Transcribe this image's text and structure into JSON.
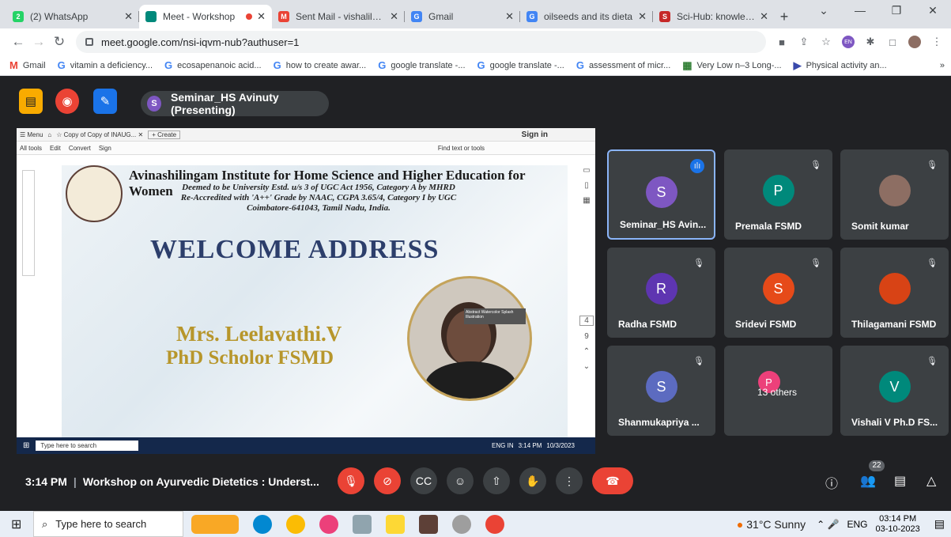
{
  "tabs": [
    {
      "title": "(2) WhatsApp",
      "color": "#25d366",
      "glyph": "2"
    },
    {
      "title": "Meet - Workshop",
      "color": "#00897b",
      "glyph": "",
      "active": true
    },
    {
      "title": "Sent Mail - vishalilekh",
      "color": "#ea4335",
      "glyph": "M"
    },
    {
      "title": "Gmail",
      "color": "#4285f4",
      "glyph": "G"
    },
    {
      "title": "oilseeds and its dieta",
      "color": "#4285f4",
      "glyph": "G"
    },
    {
      "title": "Sci-Hub: knowledge",
      "color": "#c62828",
      "glyph": "S"
    }
  ],
  "address": {
    "url": "meet.google.com/nsi-iqvm-nub?authuser=1"
  },
  "bookmarks": [
    "Gmail",
    "vitamin a deficiency...",
    "ecosapenanoic acid...",
    "how to create awar...",
    "google translate -...",
    "google translate -...",
    "assessment of micr...",
    "Very Low n–3 Long-...",
    "Physical activity an..."
  ],
  "meeting": {
    "presenting": "Seminar_HS Avinuty (Presenting)",
    "presenter_initial": "S",
    "time": "3:14 PM",
    "title": "Workshop on Ayurvedic Dietetics : Underst...",
    "participants_count": "22"
  },
  "shared_screen": {
    "viewer_title": "Copy of Copy of INAUG...",
    "viewer_create": "+ Create",
    "signin": "Sign in",
    "menu_items": [
      "All tools",
      "Edit",
      "Convert",
      "Sign"
    ],
    "find": "Find text or tools",
    "page_num": "4",
    "page_total": "9",
    "slide": {
      "institution": "Avinashilingam Institute for Home Science and Higher Education for Women",
      "line1": "Deemed to be University Estd. u/s 3 of UGC Act 1956, Category A by MHRD",
      "line2": "Re-Accredited with 'A++' Grade by NAAC, CGPA 3.65/4, Category I by UGC",
      "line3": "Coimbatore-641043, Tamil Nadu, India.",
      "heading": "WELCOME ADDRESS",
      "speaker_name": "Mrs. Leelavathi.V",
      "speaker_title": "PhD Scholor FSMD",
      "tooltip": "Abstract Watercolor Splash Illustration"
    },
    "inner_search": "Type here to search",
    "inner_time": "3:14 PM",
    "inner_date": "10/3/2023",
    "inner_lang": "ENG IN"
  },
  "participants": [
    {
      "name": "Seminar_HS Avin...",
      "initial": "S",
      "color": "#7e57c2",
      "speaking": true
    },
    {
      "name": "Premala FSMD",
      "initial": "P",
      "color": "#00897b"
    },
    {
      "name": "Somit kumar",
      "initial": "",
      "color": "#8d6e63",
      "photo": true
    },
    {
      "name": "Radha FSMD",
      "initial": "R",
      "color": "#5e35b1"
    },
    {
      "name": "Sridevi FSMD",
      "initial": "S",
      "color": "#e64a19"
    },
    {
      "name": "Thilagamani FSMD",
      "initial": "",
      "color": "#d84315",
      "photo": true
    },
    {
      "name": "Shanmukapriya ...",
      "initial": "S",
      "color": "#5c6bc0"
    },
    {
      "name": "13 others",
      "initial": "P",
      "color": "#ec407a"
    },
    {
      "name": "Vishali V Ph.D FS...",
      "initial": "V",
      "color": "#00897b"
    }
  ],
  "taskbar": {
    "search": "Type here to search",
    "weather": "31°C  Sunny",
    "lang": "ENG",
    "time": "03:14 PM",
    "date": "03-10-2023"
  }
}
